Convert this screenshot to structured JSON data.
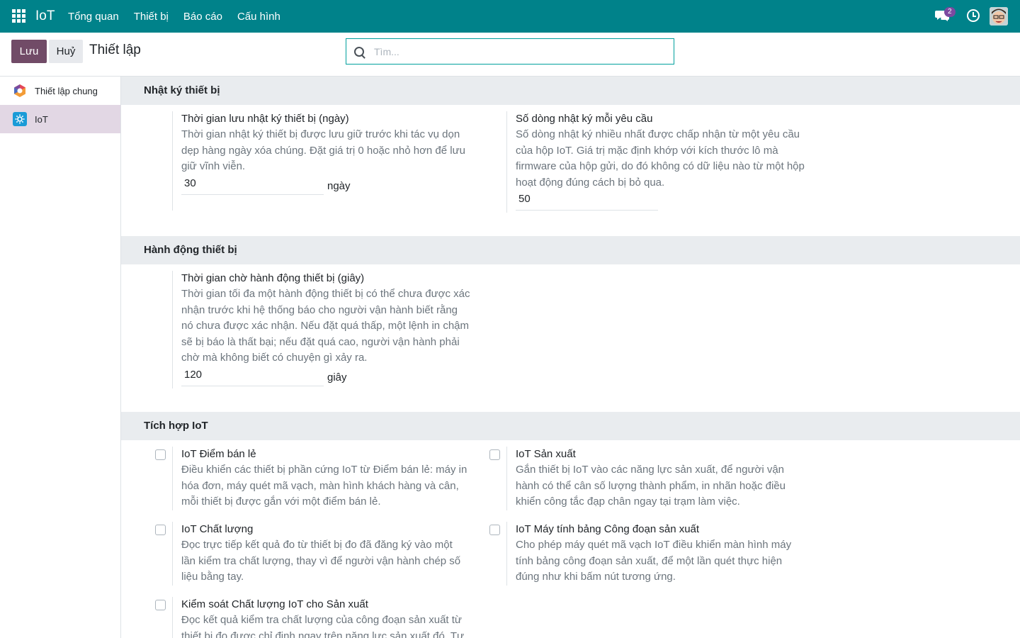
{
  "app": {
    "brand": "IoT"
  },
  "nav": {
    "menu": [
      "Tổng quan",
      "Thiết bị",
      "Báo cáo",
      "Cấu hình"
    ],
    "message_count": "2"
  },
  "control": {
    "save_label": "Lưu",
    "cancel_label": "Huỷ",
    "title": "Thiết lập",
    "search_placeholder": "Tìm..."
  },
  "sidebar": {
    "items": [
      {
        "label": "Thiết lập chung",
        "icon": "odoo-logo-icon"
      },
      {
        "label": "IoT",
        "icon": "iot-gear-icon"
      }
    ]
  },
  "sections": {
    "logs": {
      "title": "Nhật ký thiết bị",
      "retention": {
        "title": "Thời gian lưu nhật ký thiết bị (ngày)",
        "desc": "Thời gian nhật ký thiết bị được lưu giữ trước khi tác vụ dọn dẹp hàng ngày xóa chúng. Đặt giá trị 0 hoặc nhỏ hơn để lưu giữ vĩnh viễn.",
        "value": "30",
        "unit": "ngày"
      },
      "lines": {
        "title": "Số dòng nhật ký mỗi yêu cầu",
        "desc": "Số dòng nhật ký nhiều nhất được chấp nhận từ một yêu cầu của hộp IoT. Giá trị mặc định khớp với kích thước lô mà firmware của hộp gửi, do đó không có dữ liệu nào từ một hộp hoạt động đúng cách bị bỏ qua.",
        "value": "50"
      }
    },
    "actions": {
      "title": "Hành động thiết bị",
      "timeout": {
        "title": "Thời gian chờ hành động thiết bị (giây)",
        "desc": "Thời gian tối đa một hành động thiết bị có thể chưa được xác nhận trước khi hệ thống báo cho người vận hành biết rằng nó chưa được xác nhận. Nếu đặt quá thấp, một lệnh in chậm sẽ bị báo là thất bại; nếu đặt quá cao, người vận hành phải chờ mà không biết có chuyện gì xảy ra.",
        "value": "120",
        "unit": "giây"
      }
    },
    "integrations": {
      "title": "Tích hợp IoT",
      "items": [
        {
          "title": "IoT Điểm bán lẻ",
          "desc": "Điều khiển các thiết bị phần cứng IoT từ Điểm bán lẻ: máy in hóa đơn, máy quét mã vạch, màn hình khách hàng và cân, mỗi thiết bị được gắn với một điểm bán lẻ.",
          "checked": false
        },
        {
          "title": "IoT Sản xuất",
          "desc": "Gắn thiết bị IoT vào các năng lực sản xuất, để người vận hành có thể cân số lượng thành phẩm, in nhãn hoặc điều khiển công tắc đạp chân ngay tại trạm làm việc.",
          "checked": false
        },
        {
          "title": "IoT Chất lượng",
          "desc": "Đọc trực tiếp kết quả đo từ thiết bị đo đã đăng ký vào một lần kiểm tra chất lượng, thay vì để người vận hành chép số liệu bằng tay.",
          "checked": false
        },
        {
          "title": "IoT Máy tính bảng Công đoạn sản xuất",
          "desc": "Cho phép máy quét mã vạch IoT điều khiển màn hình máy tính bảng công đoạn sản xuất, để một lần quét thực hiện đúng như khi bấm nút tương ứng.",
          "checked": false
        },
        {
          "title": "Kiểm soát Chất lượng IoT cho Sản xuất",
          "desc": "Đọc kết quả kiểm tra chất lượng của công đoạn sản xuất từ thiết bị đo được chỉ định ngay trên năng lực sản xuất đó. Tự",
          "checked": false
        }
      ]
    }
  },
  "colors": {
    "navbar": "#00828a",
    "primary": "#714b67",
    "active_sidebar": "#e2d7e4",
    "section_bg": "#e9ecef"
  }
}
